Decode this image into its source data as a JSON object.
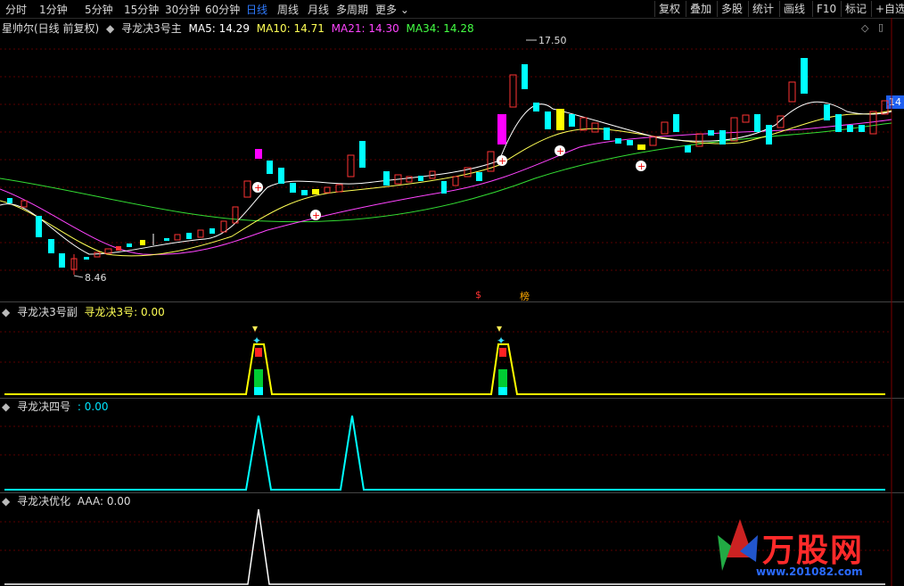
{
  "toolbar": {
    "periods": [
      "分时",
      "1分钟",
      "5分钟",
      "15分钟",
      "30分钟",
      "60分钟",
      "日线",
      "周线",
      "月线",
      "多周期",
      "更多"
    ],
    "active_period": "日线",
    "right_items": [
      "复权",
      "叠加",
      "多股",
      "统计",
      "画线",
      "F10",
      "标记",
      "+自选"
    ]
  },
  "main_panel": {
    "stock": "星帅尔(日线 前复权)",
    "indicator": "寻龙决3号主",
    "ma": [
      {
        "label": "MA5: 14.29",
        "color": "#ffffff"
      },
      {
        "label": "MA10: 14.71",
        "color": "#ffff55"
      },
      {
        "label": "MA21: 14.30",
        "color": "#ff44ff"
      },
      {
        "label": "MA34: 14.28",
        "color": "#44ff44"
      }
    ],
    "high_label": "17.50",
    "low_label": "8.46",
    "price_tag": "14",
    "marker_s": "$",
    "marker_bang": "榜"
  },
  "panel2": {
    "title": "寻龙决3号副",
    "value_label": "寻龙决3号: 0.00"
  },
  "panel3": {
    "title": "寻龙决四号",
    "value_label": ": 0.00"
  },
  "panel4": {
    "title": "寻龙决优化",
    "value_label": "AAA: 0.00"
  },
  "watermark": {
    "brand": "万股网",
    "url": "www.201082.com"
  },
  "colors": {
    "up": "#ff3333",
    "down": "#00ffff",
    "ma5": "#ffffff",
    "ma10": "#ffff55",
    "ma21": "#ff44ff",
    "ma34": "#44ff44",
    "signal": "#ffff00",
    "panel3": "#00ffff",
    "panel4": "#ffffff",
    "accent": "#2f7bff"
  }
}
